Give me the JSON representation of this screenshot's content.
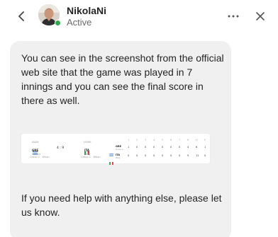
{
  "header": {
    "contact_name": "NikolaNi",
    "presence_status": "Active",
    "presence_color": "#2fa94e"
  },
  "icons": {
    "back": "chevron-left-icon",
    "more": "more-horizontal-icon",
    "close": "close-icon"
  },
  "message": {
    "paragraph1": "You can see in the screenshot from the official web site that the game was played in 7 innings and you can see the final score in there as well.",
    "paragraph2": "If you need help with anything else, please let us know."
  },
  "scoreboard": {
    "away_label": "AWAY",
    "home_label": "HOME",
    "away_team": "GRE",
    "home_team": "ITA",
    "away_team_full": "Greece",
    "home_team_full": "Italy",
    "away_group": "Group C · Whan",
    "home_group": "Group C · Whan",
    "result": "4 : 9",
    "innings": [
      "1",
      "2",
      "3",
      "4",
      "5",
      "6",
      "7",
      "R",
      "H",
      "E"
    ],
    "rows": [
      {
        "team": "GRE",
        "sub": "Greece",
        "cells": [
          "1",
          "0",
          "0",
          "0",
          "0",
          "0",
          "0",
          "4",
          "6",
          "1"
        ]
      },
      {
        "team": "ITA",
        "sub": "Italy",
        "cells": [
          "0",
          "0",
          "0",
          "0",
          "0",
          "0",
          "0",
          "9",
          "11",
          "0"
        ]
      }
    ]
  }
}
